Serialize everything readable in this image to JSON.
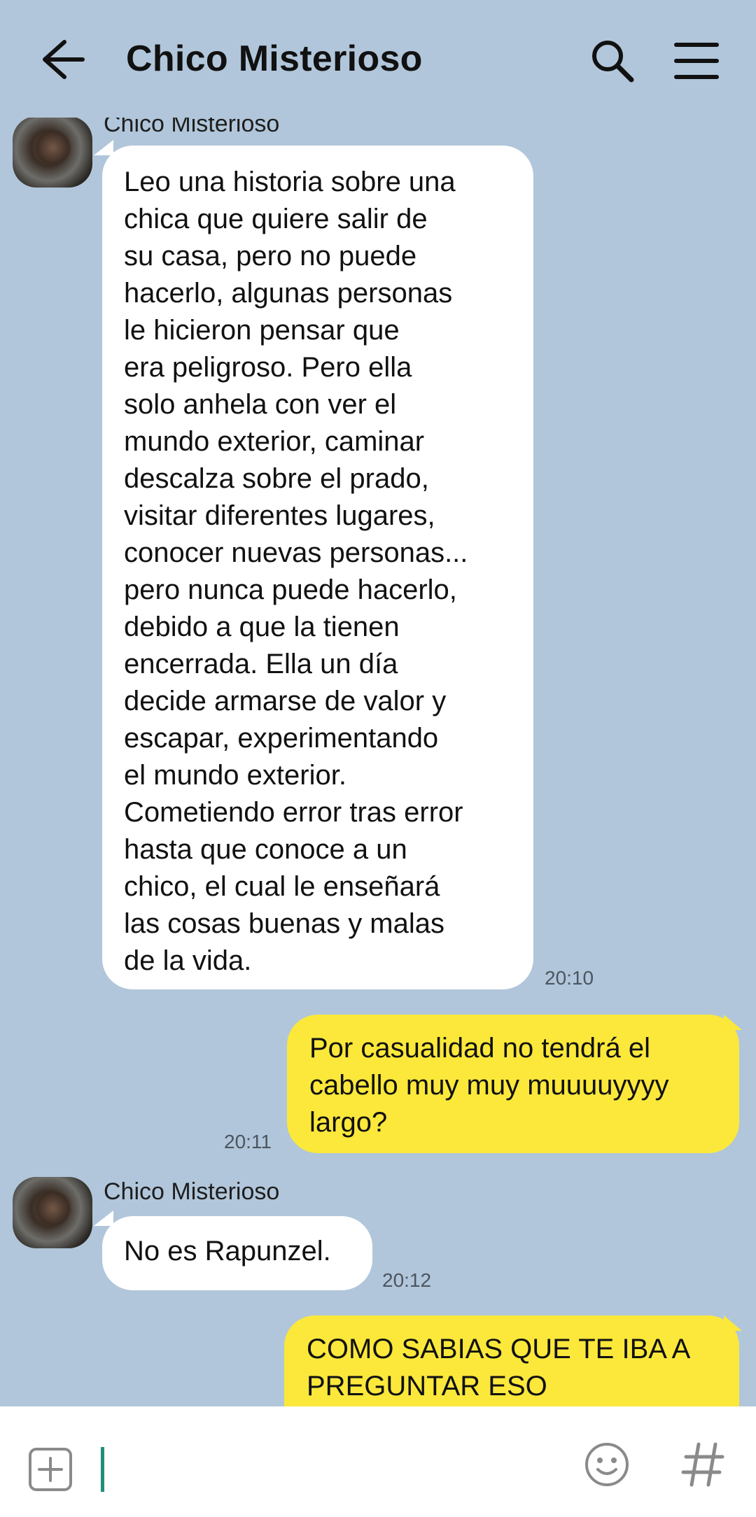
{
  "header": {
    "title": "Chico Misterioso"
  },
  "icons": {
    "back": "arrow-left-icon",
    "search": "search-icon",
    "menu": "hamburger-menu-icon",
    "add": "plus-square-icon",
    "emoji": "smiley-icon",
    "hashtag": "hashtag-icon"
  },
  "colors": {
    "background": "#b1c6da",
    "incoming_bubble": "#ffffff",
    "outgoing_bubble": "#fbe83b",
    "cursor": "#1f8f7a"
  },
  "messages": [
    {
      "direction": "incoming",
      "sender": "Chico Misterioso",
      "text": "Leo una historia sobre una\nchica que quiere salir de\nsu casa, pero no puede\nhacerlo, algunas personas\nle hicieron pensar que\nera peligroso. Pero ella\nsolo anhela con ver el\nmundo exterior, caminar\ndescalza sobre el prado,\nvisitar diferentes lugares,\nconocer nuevas personas...\npero nunca puede hacerlo,\ndebido a que la tienen\nencerrada. Ella un día\ndecide armarse de valor y\nescapar, experimentando\nel mundo exterior.\nCometiendo error tras error\nhasta que conoce a un\nchico, el cual le enseñará\nlas cosas buenas y malas\nde la vida.",
      "time": "20:10"
    },
    {
      "direction": "outgoing",
      "text": "Por casualidad no tendrá el\ncabello muy muy muuuuyyyy\nlargo?",
      "time": "20:11"
    },
    {
      "direction": "incoming",
      "sender": "Chico Misterioso",
      "text": "No es Rapunzel.",
      "time": "20:12"
    },
    {
      "direction": "outgoing",
      "text": "COMO SABIAS QUE TE IBA A\nPREGUNTAR ESO",
      "time": ""
    }
  ],
  "composer": {
    "value": ""
  }
}
